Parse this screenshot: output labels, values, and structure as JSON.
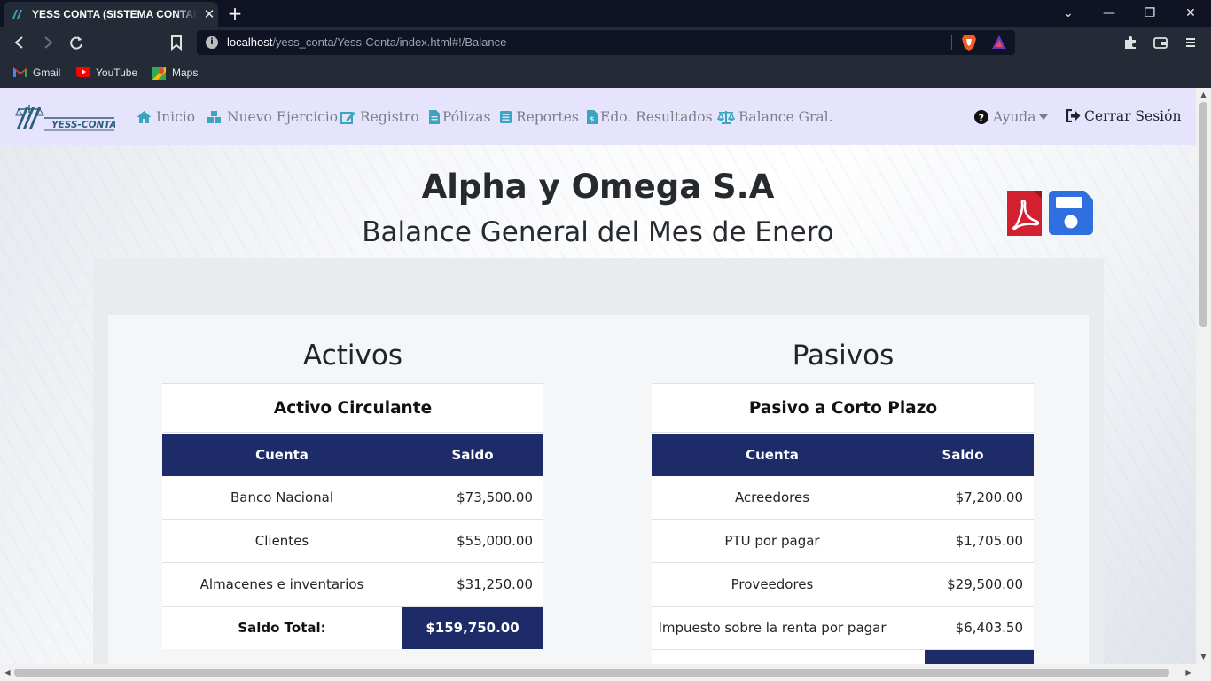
{
  "browser": {
    "tab_title": "YESS CONTA (SISTEMA CONTABLE)",
    "tab_close": "✕",
    "new_tab": "+",
    "url_host": "localhost",
    "url_path": "/yess_conta/Yess-Conta/index.html#!/Balance",
    "bookmarks": [
      {
        "label": "Gmail",
        "icon": "gmail-icon"
      },
      {
        "label": "YouTube",
        "icon": "youtube-icon"
      },
      {
        "label": "Maps",
        "icon": "maps-icon"
      }
    ],
    "window_controls": {
      "tabs_menu": "⌄",
      "minimize": "—",
      "restore": "❐",
      "close": "✕"
    }
  },
  "navbar": {
    "logo_text": "YESS-CONTA",
    "items": [
      {
        "label": "Inicio",
        "icon": "home-icon"
      },
      {
        "label": "Nuevo Ejercicio",
        "icon": "cubes-icon"
      },
      {
        "label": "Registro",
        "icon": "edit-icon"
      },
      {
        "label": "Pólizas",
        "icon": "document-icon"
      },
      {
        "label": "Reportes",
        "icon": "list-icon"
      },
      {
        "label": "Edo. Resultados",
        "icon": "invoice-icon"
      },
      {
        "label": "Balance Gral.",
        "icon": "balance-scale-icon"
      }
    ],
    "help": {
      "label": "Ayuda",
      "icon": "question-circle-icon"
    },
    "logout": {
      "label": "Cerrar Sesión",
      "icon": "sign-out-icon"
    }
  },
  "header": {
    "company": "Alpha y Omega S.A",
    "title": "Balance General del Mes de Enero",
    "pdf_button": "pdf-icon",
    "save_button": "save-icon"
  },
  "activos": {
    "title": "Activos",
    "card_title": "Activo Circulante",
    "col_cuenta": "Cuenta",
    "col_saldo": "Saldo",
    "rows": [
      {
        "cuenta": "Banco Nacional",
        "saldo": "$73,500.00"
      },
      {
        "cuenta": "Clientes",
        "saldo": "$55,000.00"
      },
      {
        "cuenta": "Almacenes e inventarios",
        "saldo": "$31,250.00"
      }
    ],
    "total_label": "Saldo Total:",
    "total_value": "$159,750.00"
  },
  "pasivos": {
    "title": "Pasivos",
    "card_title": "Pasivo a Corto Plazo",
    "col_cuenta": "Cuenta",
    "col_saldo": "Saldo",
    "rows": [
      {
        "cuenta": "Acreedores",
        "saldo": "$7,200.00"
      },
      {
        "cuenta": "PTU por pagar",
        "saldo": "$1,705.00"
      },
      {
        "cuenta": "Proveedores",
        "saldo": "$29,500.00"
      },
      {
        "cuenta": "Impuesto sobre la renta por pagar",
        "saldo": "$6,403.50"
      }
    ]
  },
  "colors": {
    "navbar_bg": "#e6e3fd",
    "table_header": "#1d2b69",
    "icon_teal": "#3aa5bd",
    "pdf_red": "#d32030",
    "save_blue": "#2f6fe0"
  }
}
